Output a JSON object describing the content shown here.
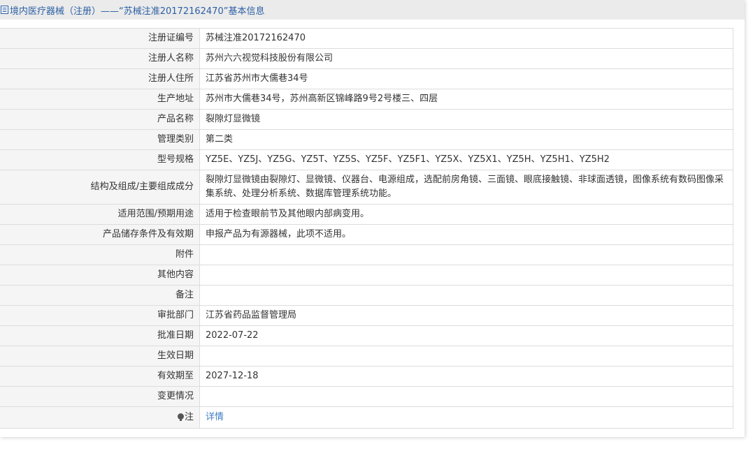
{
  "header": {
    "title": "境内医疗器械（注册）——“苏械注准20172162470”基本信息"
  },
  "rows": [
    {
      "label": "注册证编号",
      "value": "苏械注准20172162470"
    },
    {
      "label": "注册人名称",
      "value": "苏州六六视觉科技股份有限公司"
    },
    {
      "label": "注册人住所",
      "value": "江苏省苏州市大儒巷34号"
    },
    {
      "label": "生产地址",
      "value": "苏州市大儒巷34号，苏州高新区锦峰路9号2号楼三、四层"
    },
    {
      "label": "产品名称",
      "value": "裂隙灯显微镜"
    },
    {
      "label": "管理类别",
      "value": "第二类"
    },
    {
      "label": "型号规格",
      "value": "YZ5E、YZ5J、YZ5G、YZ5T、YZ5S、YZ5F、YZ5F1、YZ5X、YZ5X1、YZ5H、YZ5H1、YZ5H2"
    },
    {
      "label": "结构及组成/主要组成成分",
      "value": "裂隙灯显微镜由裂隙灯、显微镜、仪器台、电源组成，选配前房角镜、三面镜、眼底接触镜、非球面透镜，图像系统有数码图像采集系统、处理分析系统、数据库管理系统功能。"
    },
    {
      "label": "适用范围/预期用途",
      "value": "适用于检查眼前节及其他眼内部病变用。"
    },
    {
      "label": "产品储存条件及有效期",
      "value": "申报产品为有源器械，此项不适用。"
    },
    {
      "label": "附件",
      "value": ""
    },
    {
      "label": "其他内容",
      "value": ""
    },
    {
      "label": "备注",
      "value": ""
    },
    {
      "label": "审批部门",
      "value": "江苏省药品监督管理局"
    },
    {
      "label": "批准日期",
      "value": "2022-07-22"
    },
    {
      "label": "生效日期",
      "value": ""
    },
    {
      "label": "有效期至",
      "value": "2027-12-18"
    },
    {
      "label": "变更情况",
      "value": ""
    }
  ],
  "note": {
    "label": "注",
    "link_text": "详情"
  }
}
